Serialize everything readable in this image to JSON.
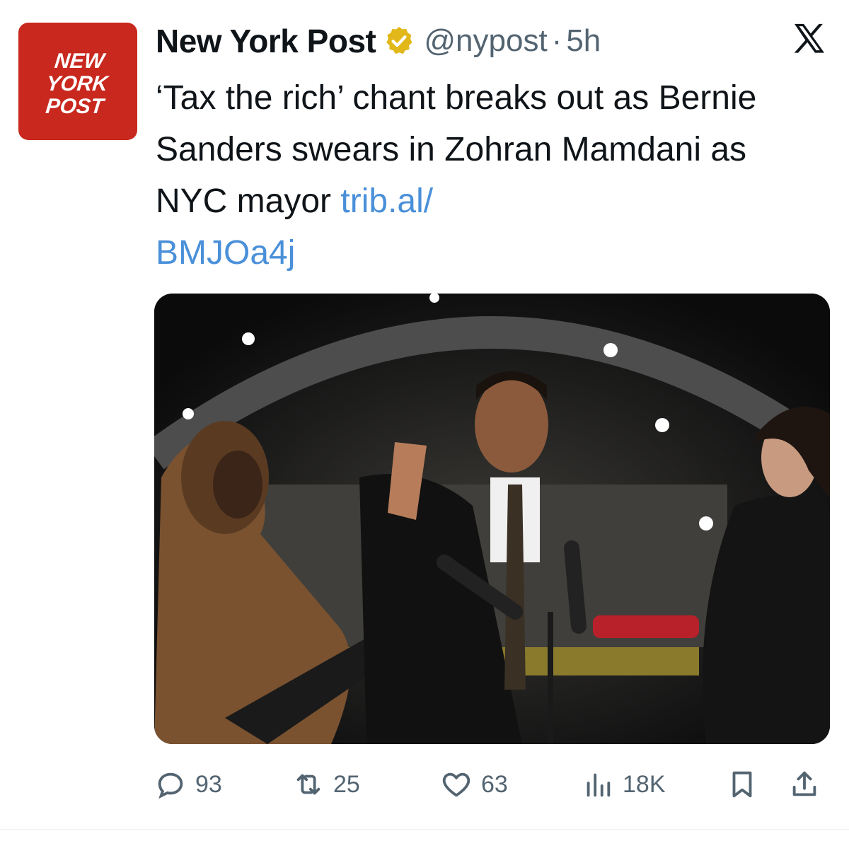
{
  "author": {
    "name": "New York Post",
    "handle": "@nypost",
    "separator": "·",
    "time": "5h",
    "logo_text": [
      "NEW",
      "YORK",
      "POST"
    ]
  },
  "tweet": {
    "text": "‘Tax the rich’ chant breaks out as Bernie Sanders swears in Zohran Mamdani as NYC mayor ",
    "link_line1": "trib.al/",
    "link_line2": "BMJOa4j"
  },
  "actions": {
    "replies": "93",
    "reposts": "25",
    "likes": "63",
    "views": "18K"
  },
  "icons": {
    "verified": "verified-badge-icon",
    "x": "x-logo-icon",
    "reply": "reply-icon",
    "repost": "repost-icon",
    "like": "like-icon",
    "views": "views-icon",
    "bookmark": "bookmark-icon",
    "share": "share-icon"
  },
  "colors": {
    "logo_red": "#c8281e",
    "link": "#4a90d9",
    "muted": "#536471",
    "verified_gold": "#e2b719"
  }
}
